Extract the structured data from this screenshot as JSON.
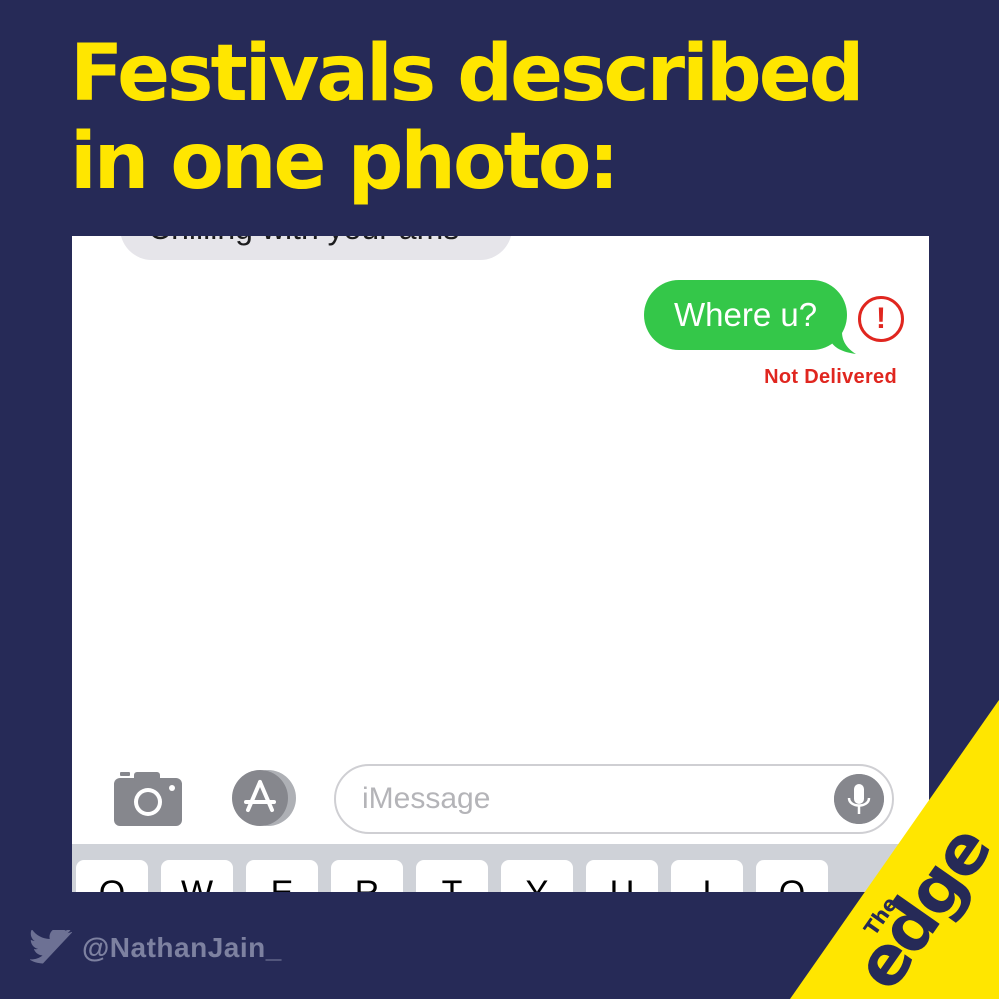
{
  "headline": "Festivals described in one photo:",
  "messages": {
    "previous_text": "Chilling with your ams",
    "sent_text": "Where u?",
    "error_glyph": "!",
    "status": "Not Delivered"
  },
  "composer": {
    "placeholder": "iMessage"
  },
  "keyboard": {
    "keys": [
      "Q",
      "W",
      "E",
      "R",
      "T",
      "Y",
      "U",
      "I",
      "O"
    ]
  },
  "credit": {
    "handle": "@NathanJain_"
  },
  "brand": {
    "name_small": "The",
    "name_large": "edge"
  },
  "colors": {
    "background": "#262a57",
    "headline": "#ffe600",
    "sent_bubble": "#34c749",
    "error": "#e0261f",
    "brand_yellow": "#ffe600"
  },
  "icons": {
    "camera": "camera-icon",
    "appstore": "appstore-icon",
    "microphone": "microphone-icon",
    "twitter": "twitter-bird-icon",
    "error": "exclamation-circle-icon"
  }
}
